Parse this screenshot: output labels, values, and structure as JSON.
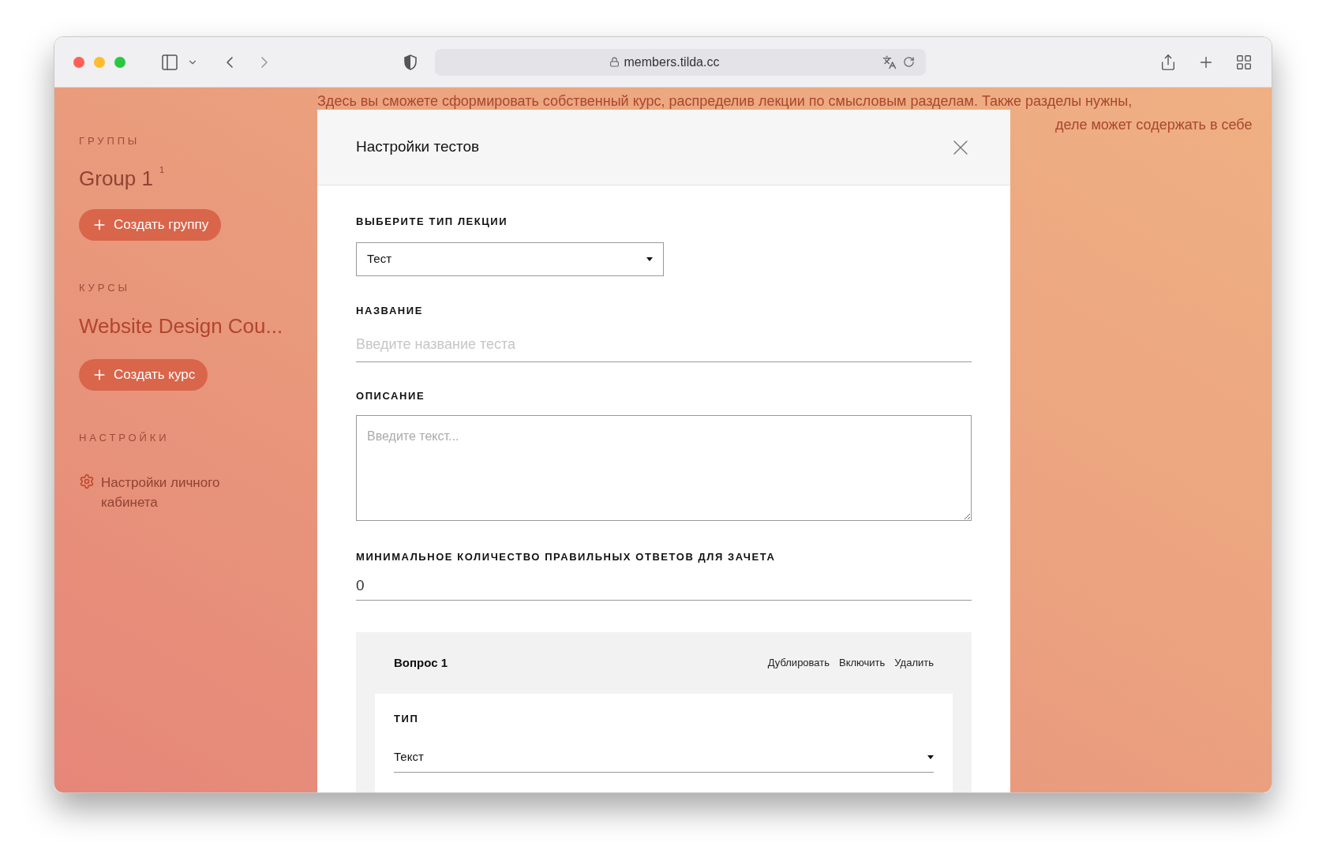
{
  "browser": {
    "url": "members.tilda.cc"
  },
  "sidebar": {
    "groups_heading": "ГРУППЫ",
    "groups": [
      {
        "name": "Group 1",
        "count": "1"
      }
    ],
    "create_group_button": "Создать группу",
    "courses_heading": "КУРСЫ",
    "courses": [
      {
        "name": "Website Design Cou..."
      }
    ],
    "create_course_button": "Создать курс",
    "settings_heading": "НАСТРОЙКИ",
    "settings_items": [
      {
        "label": "Настройки личного кабинета"
      }
    ]
  },
  "background_text": [
    "Здесь вы сможете сформировать собственный курс, распределив лекции по смысловым разделам. Также разделы нужны,",
    "деле может содержать в себе"
  ],
  "modal": {
    "title": "Настройки тестов",
    "lecture_type": {
      "label": "ВЫБЕРИТЕ ТИП ЛЕКЦИИ",
      "value": "Тест"
    },
    "name": {
      "label": "НАЗВАНИЕ",
      "placeholder": "Введите название теста"
    },
    "description": {
      "label": "ОПИСАНИЕ",
      "placeholder": "Введите текст..."
    },
    "min_correct": {
      "label": "МИНИМАЛЬНОЕ КОЛИЧЕСТВО ПРАВИЛЬНЫХ ОТВЕТОВ ДЛЯ ЗАЧЕТА",
      "value": "0"
    },
    "question": {
      "title": "Вопрос 1",
      "actions": [
        "Дублировать",
        "Включить",
        "Удалить"
      ],
      "type": {
        "label": "ТИП",
        "value": "Текст"
      }
    }
  }
}
